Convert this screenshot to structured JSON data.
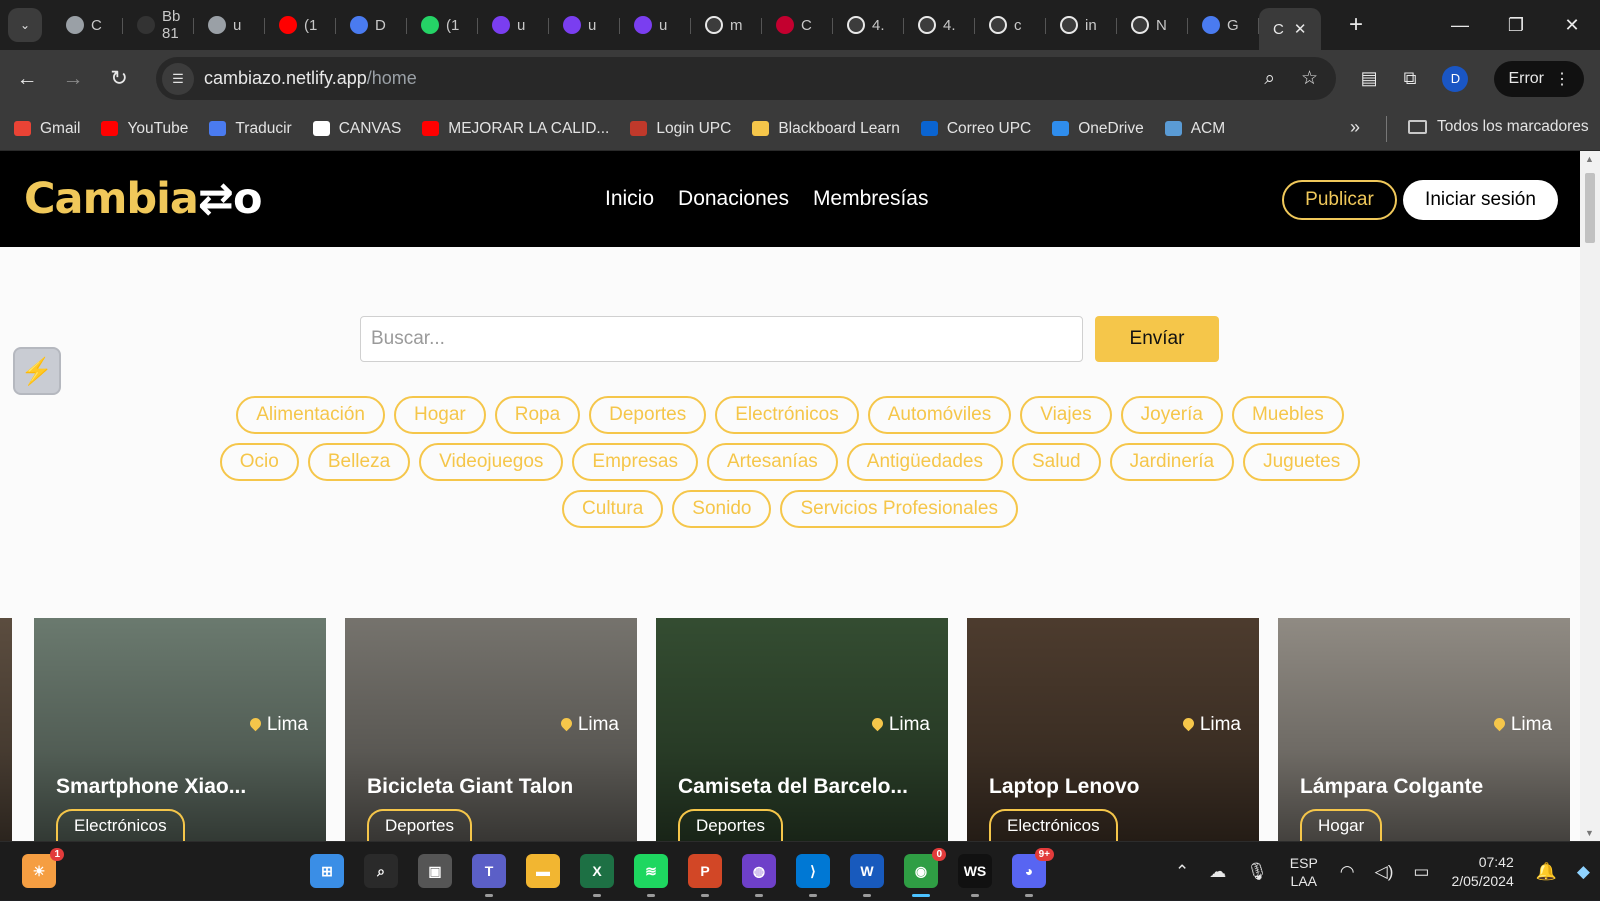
{
  "browser": {
    "tabs": [
      {
        "label": "C",
        "icon": "globe-icon",
        "color": "#9aa0a6"
      },
      {
        "label": "Bb 81",
        "icon": "blackboard-icon",
        "color": "#333333"
      },
      {
        "label": "u",
        "icon": "globe-icon",
        "color": "#9aa0a6"
      },
      {
        "label": "(1",
        "icon": "youtube-icon",
        "color": "#ff0000"
      },
      {
        "label": "D",
        "icon": "docs-icon",
        "color": "#4a7bf0"
      },
      {
        "label": "(1",
        "icon": "whatsapp-icon",
        "color": "#25d366"
      },
      {
        "label": "u",
        "icon": "upc-icon",
        "color": "#7a3ef0"
      },
      {
        "label": "u",
        "icon": "upc-icon",
        "color": "#7a3ef0"
      },
      {
        "label": "u",
        "icon": "upc-icon",
        "color": "#7a3ef0"
      },
      {
        "label": "m",
        "icon": "google-icon",
        "color": "#ffffff"
      },
      {
        "label": "C",
        "icon": "angular-icon",
        "color": "#c3002f"
      },
      {
        "label": "4.",
        "icon": "google-icon",
        "color": "#ffffff"
      },
      {
        "label": "4.",
        "icon": "google-icon",
        "color": "#ffffff"
      },
      {
        "label": "c",
        "icon": "google-icon",
        "color": "#ffffff"
      },
      {
        "label": "in",
        "icon": "google-icon",
        "color": "#ffffff"
      },
      {
        "label": "N",
        "icon": "chrome-icon",
        "color": "#ffffff"
      },
      {
        "label": "G",
        "icon": "translate-icon",
        "color": "#4a7bf0"
      }
    ],
    "active_tab": {
      "label": "C",
      "close": "✕"
    },
    "new_tab": "+",
    "window_controls": {
      "minimize": "—",
      "restore": "❐",
      "close": "✕"
    },
    "url_domain": "cambiazo.netlify.app",
    "url_path": "/home",
    "profile_initial": "D",
    "error_label": "Error",
    "bookmarks": [
      {
        "label": "Gmail",
        "icon": "gmail-icon",
        "color": "#ea4335"
      },
      {
        "label": "YouTube",
        "icon": "youtube-icon",
        "color": "#ff0000"
      },
      {
        "label": "Traducir",
        "icon": "translate-icon",
        "color": "#4a7bf0"
      },
      {
        "label": "CANVAS",
        "icon": "canvas-icon",
        "color": "#ffffff"
      },
      {
        "label": "MEJORAR LA CALID...",
        "icon": "youtube-icon",
        "color": "#ff0000"
      },
      {
        "label": "Login UPC",
        "icon": "upc-icon",
        "color": "#c0392b"
      },
      {
        "label": "Blackboard Learn",
        "icon": "blackboard-icon",
        "color": "#f5c64a"
      },
      {
        "label": "Correo UPC",
        "icon": "outlook-icon",
        "color": "#0a64d1"
      },
      {
        "label": "OneDrive",
        "icon": "onedrive-icon",
        "color": "#2f8ded"
      },
      {
        "label": "ACM",
        "icon": "acm-icon",
        "color": "#5a9bd5"
      }
    ],
    "bookmarks_more": "»",
    "all_bookmarks": "Todos los marcadores"
  },
  "site": {
    "logo_main": "Cambia",
    "logo_mark": "⇄o",
    "nav": [
      "Inicio",
      "Donaciones",
      "Membresías"
    ],
    "publish_label": "Publicar",
    "login_label": "Iniciar sesión",
    "search_placeholder": "Buscar...",
    "send_label": "Envíar",
    "categories": [
      "Alimentación",
      "Hogar",
      "Ropa",
      "Deportes",
      "Electrónicos",
      "Automóviles",
      "Viajes",
      "Joyería",
      "Muebles",
      "Ocio",
      "Belleza",
      "Videojuegos",
      "Empresas",
      "Artesanías",
      "Antigüedades",
      "Salud",
      "Jardinería",
      "Juguetes",
      "Cultura",
      "Sonido",
      "Servicios Profesionales"
    ],
    "products": [
      {
        "title": "Smartphone Xiao...",
        "location": "Lima",
        "category": "Electrónicos",
        "bg": "#7d8f82"
      },
      {
        "title": "Bicicleta Giant Talon",
        "location": "Lima",
        "category": "Deportes",
        "bg": "#8a8780"
      },
      {
        "title": "Camiseta del Barcelo...",
        "location": "Lima",
        "category": "Deportes",
        "bg": "#3d5a3a"
      },
      {
        "title": "Laptop Lenovo",
        "location": "Lima",
        "category": "Electrónicos",
        "bg": "#5a4636"
      },
      {
        "title": "Lámpara Colgante",
        "location": "Lima",
        "category": "Hogar",
        "bg": "#a9a39a"
      }
    ]
  },
  "taskbar": {
    "apps": [
      {
        "name": "widgets-icon",
        "label": "☀",
        "color": "#f59e42",
        "badge": "1"
      },
      {
        "name": "start-icon",
        "label": "⊞",
        "color": "#3a8ee6",
        "badge": ""
      },
      {
        "name": "search-icon",
        "label": "⌕",
        "color": "#2a2a2a",
        "badge": ""
      },
      {
        "name": "task-view-icon",
        "label": "▣",
        "color": "#555555",
        "badge": ""
      },
      {
        "name": "teams-icon",
        "label": "T",
        "color": "#5b5fc7",
        "badge": ""
      },
      {
        "name": "file-explorer-icon",
        "label": "▬",
        "color": "#f2b631",
        "badge": ""
      },
      {
        "name": "excel-icon",
        "label": "X",
        "color": "#1d7044",
        "badge": ""
      },
      {
        "name": "spotify-icon",
        "label": "≋",
        "color": "#1ed760",
        "badge": ""
      },
      {
        "name": "powerpoint-icon",
        "label": "P",
        "color": "#d24726",
        "badge": ""
      },
      {
        "name": "github-icon",
        "label": "◍",
        "color": "#6e40c9",
        "badge": ""
      },
      {
        "name": "vscode-icon",
        "label": "⟩",
        "color": "#0078d4",
        "badge": ""
      },
      {
        "name": "word-icon",
        "label": "W",
        "color": "#185abd",
        "badge": ""
      },
      {
        "name": "chrome-icon",
        "label": "◉",
        "color": "#2f9e44",
        "badge": "0"
      },
      {
        "name": "webstorm-icon",
        "label": "WS",
        "color": "#111111",
        "badge": ""
      },
      {
        "name": "discord-icon",
        "label": "◕",
        "color": "#5865f2",
        "badge": "9+"
      }
    ],
    "lang_top": "ESP",
    "lang_bottom": "LAA",
    "time": "07:42",
    "date": "2/05/2024"
  }
}
